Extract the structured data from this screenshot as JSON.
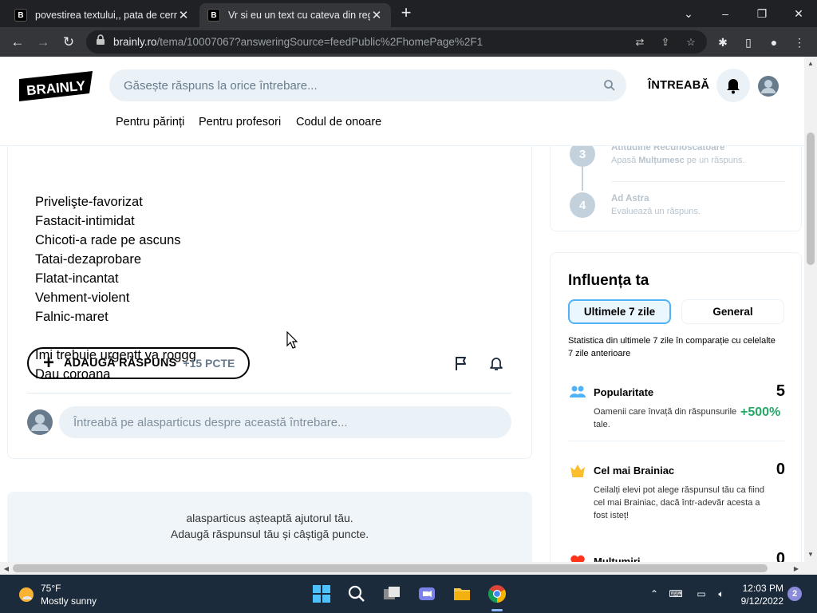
{
  "browser": {
    "tabs": [
      {
        "favicon": "B",
        "title": "povestirea textului,, pata de cerneală",
        "active": false
      },
      {
        "favicon": "B",
        "title": "Vr si eu un text cu cateva din regionalisme",
        "active": true
      }
    ],
    "url_host": "brainly.ro",
    "url_path": "/tema/10007067?answeringSource=feedPublic%2FhomePage%2F1"
  },
  "header": {
    "logo_text": "BRAINLY",
    "search_placeholder": "Găsește răspuns la orice întrebare...",
    "ask_label": "ÎNTREABĂ",
    "subnav": [
      "Pentru părinți",
      "Pentru profesori",
      "Codul de onoare"
    ]
  },
  "question": {
    "lines": [
      "Privelişte-favorizat",
      "Fastacit-intimidat",
      "Chicoti-a rade pe ascuns",
      "Tatai-dezaprobare",
      "Flatat-incantat",
      "Vehment-violent",
      "Falnic-maret",
      "",
      "Imi trebuie urgentt va roggg",
      "Dau coroana"
    ],
    "add_answer_label": "ADAUGĂ RĂSPUNS",
    "add_answer_points": "+15 PCTE",
    "comment_placeholder": "Întreabă pe alasparticus despre această întrebare..."
  },
  "waiting": {
    "line1": "alasparticus așteaptă ajutorul tău.",
    "line2": "Adaugă răspunsul tău și câștigă puncte."
  },
  "steps": [
    {
      "num": "3",
      "title": "Atitudine Recunoscătoare",
      "desc_pre": "Apasă ",
      "desc_bold": "Mulțumesc",
      "desc_post": " pe un răspuns."
    },
    {
      "num": "4",
      "title": "Ad Astra",
      "desc_pre": "Evaluează un răspuns.",
      "desc_bold": "",
      "desc_post": ""
    }
  ],
  "influence": {
    "title": "Influența ta",
    "tab_active": "Ultimele 7 zile",
    "tab_inactive": "General",
    "description": "Statistica din ultimele 7 zile în comparație cu celelalte 7 zile anterioare",
    "metrics": [
      {
        "icon": "people-icon",
        "title": "Popularitate",
        "value": "5",
        "desc": "Oamenii care învață din răspunsurile tale.",
        "growth": "+500%"
      },
      {
        "icon": "crown-icon",
        "title": "Cel mai Brainiac",
        "value": "0",
        "desc": "Ceilalți elevi pot alege răspunsul tău ca fiind cel mai Brainiac, dacă într-adevăr acesta a fost isteț!",
        "growth": ""
      },
      {
        "icon": "heart-icon",
        "title": "Mulțumiri",
        "value": "0",
        "desc": "",
        "growth": ""
      }
    ]
  },
  "taskbar": {
    "temperature": "75°F",
    "weather": "Mostly sunny",
    "time": "12:03 PM",
    "date": "9/12/2022",
    "notifications": "2"
  },
  "colors": {
    "brand_dark": "#000000",
    "search_bg": "#ebf2f7",
    "accent_blue": "#4fb3f6",
    "growth_green": "#24a865",
    "crown_gold": "#fbbe2e",
    "heart_red": "#ff341a",
    "people_blue": "#4fb3f6"
  }
}
